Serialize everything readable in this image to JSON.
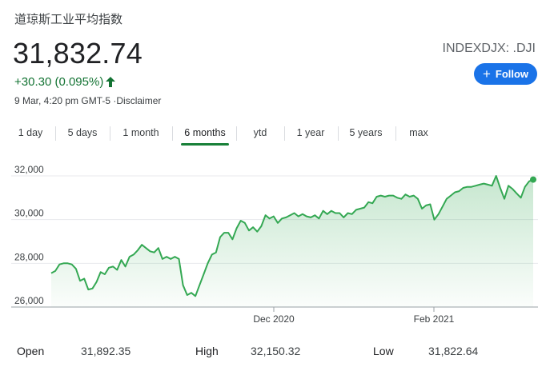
{
  "header": {
    "title": "道琼斯工业平均指数",
    "price": "31,832.74",
    "change": "+30.30 (0.095%)",
    "meta": "9 Mar, 4:20 pm GMT-5",
    "disclaimer": "·Disclaimer",
    "ticker": "INDEXDJX: .DJI",
    "follow_label": "Follow"
  },
  "colors": {
    "positive": "#137333",
    "line": "#34a853",
    "accent": "#1a73e8"
  },
  "tabs": [
    {
      "label": "1 day"
    },
    {
      "label": "5 days"
    },
    {
      "label": "1 month"
    },
    {
      "label": "6 months",
      "active": true
    },
    {
      "label": "ytd"
    },
    {
      "label": "1 year"
    },
    {
      "label": "5 years"
    },
    {
      "label": "max"
    }
  ],
  "chart_data": {
    "type": "area",
    "y_ticks": [
      "32,000",
      "30,000",
      "28,000",
      "26,000"
    ],
    "x_ticks": [
      "Dec 2020",
      "Feb 2021"
    ],
    "ylim": [
      26000,
      32000
    ],
    "grid": true,
    "series": [
      {
        "values": [
          27550,
          27650,
          27950,
          28000,
          28000,
          27950,
          27750,
          27200,
          27300,
          26800,
          26850,
          27150,
          27600,
          27500,
          27800,
          27850,
          27700,
          28150,
          27850,
          28300,
          28400,
          28600,
          28850,
          28700,
          28550,
          28500,
          28700,
          28200,
          28300,
          28200,
          28300,
          28200,
          27000,
          26550,
          26650,
          26500,
          27000,
          27500,
          28000,
          28400,
          28500,
          29200,
          29400,
          29400,
          29100,
          29600,
          29950,
          29850,
          29500,
          29650,
          29450,
          29700,
          30200,
          30050,
          30150,
          29850,
          30050,
          30100,
          30200,
          30300,
          30150,
          30250,
          30150,
          30100,
          30200,
          30050,
          30400,
          30250,
          30400,
          30300,
          30300,
          30100,
          30300,
          30250,
          30450,
          30500,
          30550,
          30800,
          30750,
          31050,
          31100,
          31050,
          31100,
          31100,
          31000,
          30950,
          31150,
          31050,
          31100,
          30950,
          30500,
          30650,
          30700,
          30000,
          30250,
          30600,
          30950,
          31100,
          31250,
          31300,
          31450,
          31500,
          31500,
          31550,
          31600,
          31650,
          31600,
          31550,
          32000,
          31450,
          30950,
          31550,
          31400,
          31200,
          31000,
          31500,
          31750,
          31833
        ]
      }
    ]
  },
  "stats": [
    {
      "label": "Open",
      "value": "31,892.35"
    },
    {
      "label": "High",
      "value": "32,150.32"
    },
    {
      "label": "Low",
      "value": "31,822.64"
    }
  ]
}
